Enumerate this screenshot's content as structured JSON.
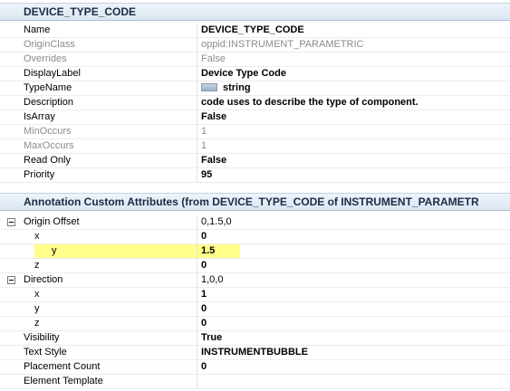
{
  "sections": {
    "properties": {
      "title": "DEVICE_TYPE_CODE"
    },
    "annotation": {
      "title": "Annotation Custom Attributes (from DEVICE_TYPE_CODE of INSTRUMENT_PARAMETR"
    }
  },
  "properties": [
    {
      "name": "Name",
      "value": "DEVICE_TYPE_CODE"
    },
    {
      "name": "OriginClass",
      "value": "oppid:INSTRUMENT_PARAMETRIC"
    },
    {
      "name": "Overrides",
      "value": "False"
    },
    {
      "name": "DisplayLabel",
      "value": "Device Type Code"
    },
    {
      "name": "TypeName",
      "value": "string"
    },
    {
      "name": "Description",
      "value": "code uses to describe the type of component."
    },
    {
      "name": "IsArray",
      "value": "False"
    },
    {
      "name": "MinOccurs",
      "value": "1"
    },
    {
      "name": "MaxOccurs",
      "value": "1"
    },
    {
      "name": "Read Only",
      "value": "False"
    },
    {
      "name": "Priority",
      "value": "95"
    }
  ],
  "annotation": [
    {
      "name": "Origin Offset",
      "value": "0,1.5,0"
    },
    {
      "name": "x",
      "value": "0"
    },
    {
      "name": "y",
      "value": "1.5"
    },
    {
      "name": "z",
      "value": "0"
    },
    {
      "name": "Direction",
      "value": "1,0,0"
    },
    {
      "name": "x",
      "value": "1"
    },
    {
      "name": "y",
      "value": "0"
    },
    {
      "name": "z",
      "value": "0"
    },
    {
      "name": "Visibility",
      "value": "True"
    },
    {
      "name": "Text Style",
      "value": "INSTRUMENTBUBBLE"
    },
    {
      "name": "Placement Count",
      "value": "0"
    },
    {
      "name": "Element Template",
      "value": ""
    }
  ],
  "colors": {
    "highlight": "#ffff8a",
    "disabled_text": "#8c8c8c",
    "header_text": "#1a2b45"
  },
  "icons": {
    "type_name": "string-type-icon",
    "expander": "minus-expander-icon"
  }
}
